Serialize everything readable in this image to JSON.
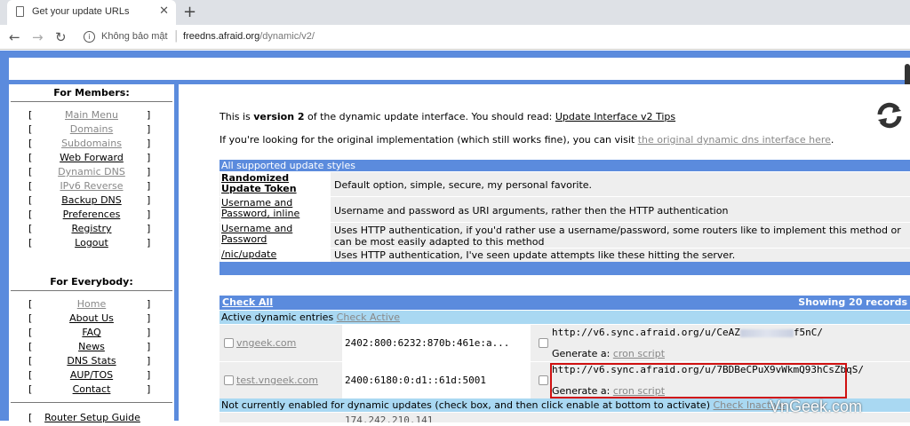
{
  "browser": {
    "tab_title": "Get your update URLs",
    "tab_close": "✕",
    "new_tab": "+",
    "security_label": "Không bảo mật",
    "url_host": "freedns.afraid.org",
    "url_path": "/dynamic/v2/"
  },
  "sidebar": {
    "members_heading": "For Members:",
    "members_items": [
      {
        "label": "Main Menu",
        "style": "dim"
      },
      {
        "label": "Domains",
        "style": "dim"
      },
      {
        "label": "Subdomains",
        "style": "dim"
      },
      {
        "label": "Web Forward",
        "style": "dark"
      },
      {
        "label": "Dynamic DNS",
        "style": "dim"
      },
      {
        "label": "IPv6 Reverse",
        "style": "dim"
      },
      {
        "label": "Backup DNS",
        "style": "dark"
      },
      {
        "label": "Preferences",
        "style": "dark"
      },
      {
        "label": "Registry",
        "style": "dark"
      },
      {
        "label": "Logout",
        "style": "dark"
      }
    ],
    "everybody_heading": "For Everybody:",
    "everybody_items": [
      {
        "label": "Home",
        "style": "dim"
      },
      {
        "label": "About Us",
        "style": "dark"
      },
      {
        "label": "FAQ",
        "style": "dark"
      },
      {
        "label": "News",
        "style": "dark"
      },
      {
        "label": "DNS Stats",
        "style": "dark"
      },
      {
        "label": "AUP/TOS",
        "style": "dark"
      },
      {
        "label": "Contact",
        "style": "dark"
      }
    ],
    "router_label": "Router Setup Guide",
    "bracket_open": "[",
    "bracket_close": "]"
  },
  "main": {
    "intro_prefix": "This is ",
    "intro_version": "version 2",
    "intro_suffix": " of the dynamic update interface. You should read: ",
    "intro_link": "Update Interface v2 Tips",
    "orig_text": "If you're looking for the original implementation (which still works fine), you can visit ",
    "orig_link": "the original dynamic dns interface here",
    "orig_end": ".",
    "styles_header": "All supported update styles",
    "styles": [
      {
        "name": "Randomized Update Token",
        "desc": "Default option, simple, secure, my personal favorite."
      },
      {
        "name": "Username and Password, inline",
        "desc": "Username and password as URI arguments, rather then the HTTP authentication"
      },
      {
        "name": "Username and Password",
        "desc": "Uses HTTP authentication, if you'd rather use a username/password, some routers like to implement this method or can be most easily adapted to this method"
      },
      {
        "name": "/nic/update",
        "desc": "Uses HTTP authentication, I've seen update attempts like these hitting the server."
      }
    ],
    "check_all": "Check All",
    "showing": "Showing 20 records",
    "active_label": "Active dynamic entries ",
    "check_active": "Check Active",
    "entries": [
      {
        "host": "vngeek.com",
        "ip": "2402:800:6232:870b:461e:a...",
        "url": "http://v6.sync.afraid.org/u/CeAZ",
        "url_end": "f5nC/",
        "generate": "Generate a: ",
        "cron": "cron script"
      },
      {
        "host": "test.vngeek.com",
        "ip": "2400:6180:0:d1::61d:5001",
        "url": "http://v6.sync.afraid.org/u/7BDBeCPuX9vWkmQ93hCsZbqS/",
        "url_end": "",
        "generate": "Generate a: ",
        "cron": "cron script"
      }
    ],
    "inactive_label": "Not currently enabled for dynamic updates (check box, and then click enable at bottom to activate) ",
    "check_inactive": "Check Inactive",
    "partial_ip": "174.242.210.141"
  },
  "watermark": "VnGeek.com",
  "colors": {
    "page_blue": "#5b8bdd",
    "light_blue": "#a9d8f2",
    "highlight_red": "#d01010"
  }
}
